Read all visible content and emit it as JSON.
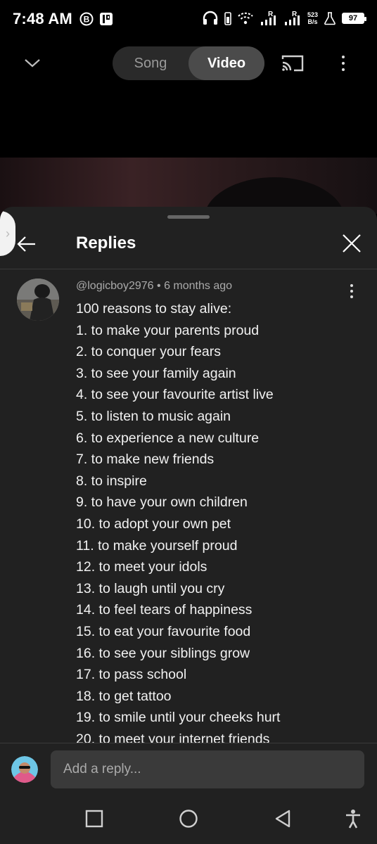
{
  "status_bar": {
    "time": "7:48 AM",
    "net_speed_value": "523",
    "net_speed_unit": "B/s",
    "battery": "97",
    "icons": [
      "b-circle-icon",
      "parking-icon",
      "headphones-icon",
      "wifi-icon",
      "signal-r-icon",
      "signal-r-icon",
      "flask-icon",
      "battery-icon"
    ]
  },
  "player": {
    "tabs": [
      {
        "label": "Song",
        "active": false
      },
      {
        "label": "Video",
        "active": true
      }
    ]
  },
  "replies": {
    "title": "Replies",
    "comment": {
      "author": "@logicboy2976",
      "separator": "•",
      "time": "6 months ago",
      "lines": [
        "100 reasons to stay alive:",
        "1. to make your parents proud",
        "2. to conquer your fears",
        "3. to see your family again",
        "4. to see your favourite artist live",
        "5. to listen to music again",
        "6. to experience a new culture",
        "7. to make new friends",
        "8. to inspire",
        "9. to have your own children",
        "10. to adopt your own pet",
        "11. to make yourself proud",
        "12. to meet your idols",
        "13. to laugh until you cry",
        "14. to feel tears of happiness",
        "15. to eat your favourite food",
        "16. to see your siblings grow",
        "17. to pass school",
        "18. to get tattoo",
        "19. to smile until your cheeks hurt",
        "20. to meet your internet friends"
      ]
    },
    "reply_input": {
      "placeholder": "Add a reply..."
    }
  },
  "colors": {
    "sheet_bg": "#212121",
    "toggle_bg": "#2a2a2a",
    "toggle_active": "#4b4b4b",
    "input_bg": "#3a3a3a",
    "meta_text": "#aaaaaa"
  }
}
